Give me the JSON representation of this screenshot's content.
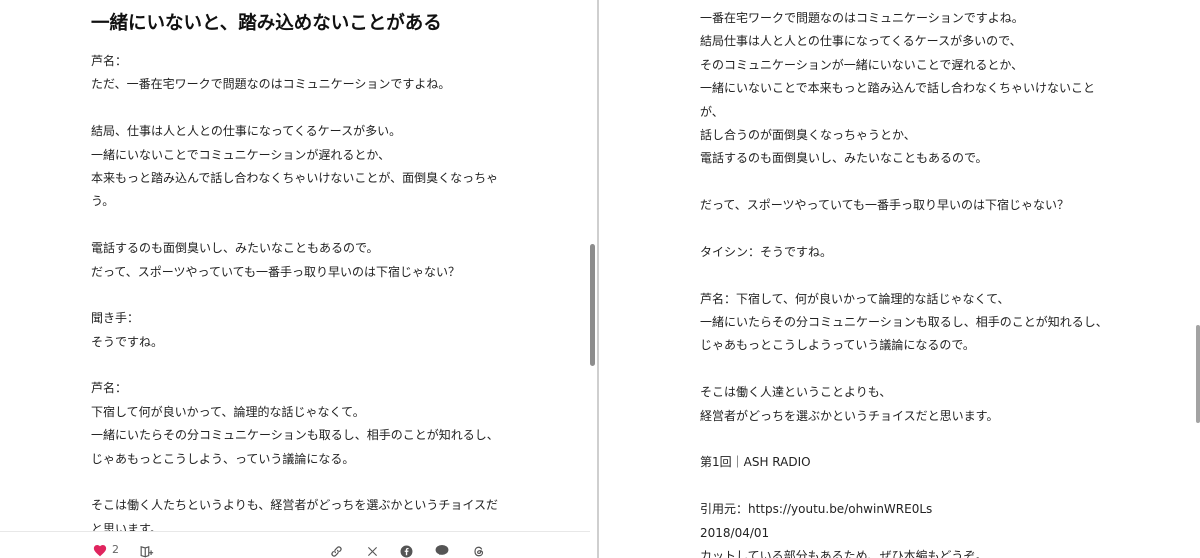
{
  "left": {
    "heading": "一緒にいないと、踏み込めないことがある",
    "lines": [
      "芦名：",
      "ただ、一番在宅ワークで問題なのはコミュニケーションですよね。",
      "",
      "結局、仕事は人と人との仕事になってくるケースが多い。",
      "一緒にいないことでコミュニケーションが遅れるとか、",
      "本来もっと踏み込んで話し合わなくちゃいけないことが、面倒臭くなっちゃ",
      "う。",
      "",
      "電話するのも面倒臭いし、みたいなこともあるので。",
      "だって、スポーツやっていても一番手っ取り早いのは下宿じゃない？",
      "",
      "聞き手：",
      "そうですね。",
      "",
      "芦名：",
      "下宿して何が良いかって、論理的な話じゃなくて。",
      "一緒にいたらその分コミュニケーションも取るし、相手のことが知れるし、",
      "じゃあもっとこうしよう、っていう議論になる。",
      "",
      "そこは働く人たちというよりも、経営者がどっちを選ぶかというチョイスだ",
      "と思います。"
    ],
    "footer": {
      "like_count": "2",
      "icons": [
        "heart-icon",
        "magazine-add-icon",
        "link-icon",
        "x-icon",
        "facebook-icon",
        "line-icon",
        "threads-icon"
      ]
    }
  },
  "right": {
    "lines": [
      "一番在宅ワークで問題なのはコミュニケーションですよね。",
      "結局仕事は人と人との仕事になってくるケースが多いので、",
      "そのコミュニケーションが一緒にいないことで遅れるとか、",
      "一緒にいないことで本来もっと踏み込んで話し合わなくちゃいけないこと",
      "が、",
      "話し合うのが面倒臭くなっちゃうとか、",
      "電話するのも面倒臭いし、みたいなこともあるので。",
      "",
      "だって、スポーツやっていても一番手っ取り早いのは下宿じゃない？",
      "",
      "タイシン：そうですね。",
      "",
      "芦名：下宿して、何が良いかって論理的な話じゃなくて、",
      "一緒にいたらその分コミュニケーションも取るし、相手のことが知れるし、",
      "じゃあもっとこうしようっていう議論になるので。",
      "",
      "そこは働く人達ということよりも、",
      "経営者がどっちを選ぶかというチョイスだと思います。",
      "",
      "第1回｜ASH RADIO",
      "",
      "引用元：https://youtu.be/ohwinWRE0Ls",
      "2018/04/01",
      "カットしている部分もあるため、ぜひ本編もどうぞ。"
    ]
  },
  "colors": {
    "heart": "#e0245e",
    "text": "#222222",
    "icon": "#555555",
    "divider": "#cfcfcf"
  }
}
